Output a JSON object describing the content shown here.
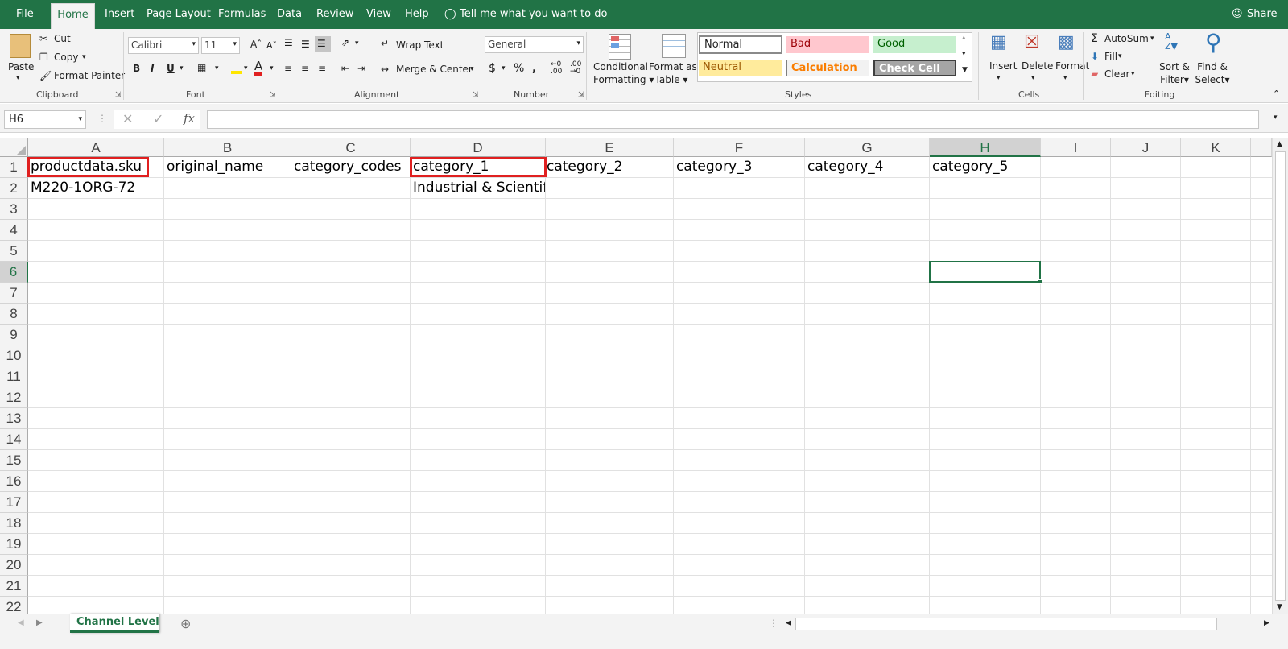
{
  "menu": {
    "file": "File",
    "home": "Home",
    "insert": "Insert",
    "page_layout": "Page Layout",
    "formulas": "Formulas",
    "data": "Data",
    "review": "Review",
    "view": "View",
    "help": "Help",
    "tell_me": "Tell me what you want to do",
    "share": "Share"
  },
  "clipboard": {
    "paste": "Paste",
    "cut": "Cut",
    "copy": "Copy",
    "format_painter": "Format Painter",
    "group": "Clipboard"
  },
  "font": {
    "name": "Calibri",
    "size": "11",
    "group": "Font"
  },
  "alignment": {
    "wrap_text": "Wrap Text",
    "merge_center": "Merge & Center",
    "group": "Alignment"
  },
  "number": {
    "format": "General",
    "group": "Number"
  },
  "styles": {
    "conditional_1": "Conditional",
    "conditional_2": "Formatting",
    "format_as_1": "Format as",
    "format_as_2": "Table",
    "normal": "Normal",
    "bad": "Bad",
    "good": "Good",
    "neutral": "Neutral",
    "calculation": "Calculation",
    "check_cell": "Check Cell",
    "group": "Styles"
  },
  "cells": {
    "insert": "Insert",
    "delete": "Delete",
    "format": "Format",
    "group": "Cells"
  },
  "editing": {
    "autosum": "AutoSum",
    "fill": "Fill",
    "clear": "Clear",
    "sort_1": "Sort &",
    "sort_2": "Filter",
    "find_1": "Find &",
    "find_2": "Select",
    "group": "Editing"
  },
  "formula_bar": {
    "name_box": "H6",
    "formula": ""
  },
  "columns": [
    "A",
    "B",
    "C",
    "D",
    "E",
    "F",
    "G",
    "H",
    "I",
    "J",
    "K"
  ],
  "rows": [
    "1",
    "2",
    "3",
    "4",
    "5",
    "6",
    "7",
    "8",
    "9",
    "10",
    "11",
    "12",
    "13",
    "14",
    "15",
    "16",
    "17",
    "18",
    "19",
    "20",
    "21",
    "22"
  ],
  "cells_data": {
    "a1": "productdata.sku",
    "b1": "original_name",
    "c1": "category_codes",
    "d1": "category_1",
    "e1": "category_2",
    "f1": "category_3",
    "g1": "category_4",
    "h1": "category_5",
    "a2": "M220-1ORG-72",
    "d2": "Industrial & Scientifi"
  },
  "selected_cell": "H6",
  "sheet_tab": "Channel Level",
  "colors": {
    "accent": "#217346",
    "highlight": "#e02020"
  }
}
